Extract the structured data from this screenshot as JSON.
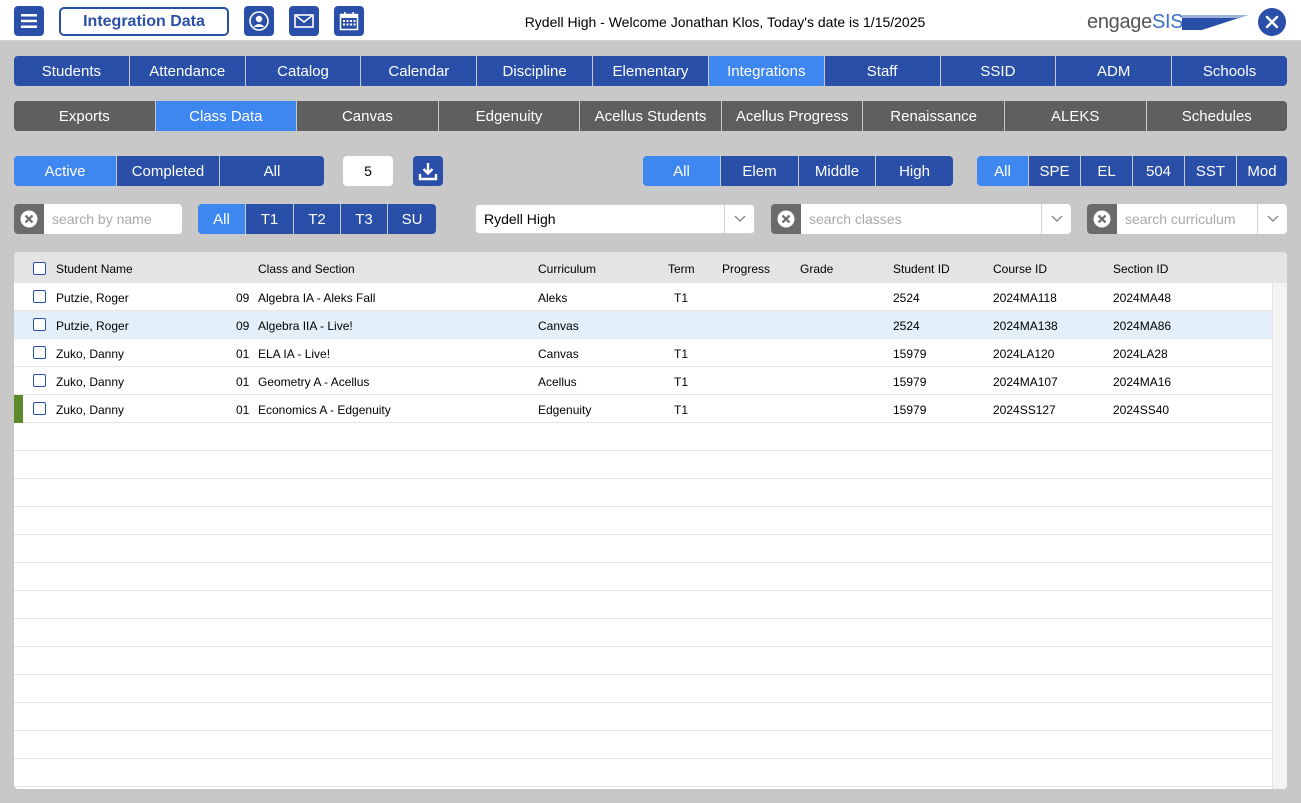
{
  "header": {
    "title": "Integration Data",
    "welcome": "Rydell High - Welcome Jonathan Klos, Today's date is 1/15/2025",
    "logo_engage": "engage",
    "logo_sis": "SIS"
  },
  "main_nav": [
    {
      "label": "Students",
      "active": false
    },
    {
      "label": "Attendance",
      "active": false
    },
    {
      "label": "Catalog",
      "active": false
    },
    {
      "label": "Calendar",
      "active": false
    },
    {
      "label": "Discipline",
      "active": false
    },
    {
      "label": "Elementary",
      "active": false
    },
    {
      "label": "Integrations",
      "active": true
    },
    {
      "label": "Staff",
      "active": false
    },
    {
      "label": "SSID",
      "active": false
    },
    {
      "label": "ADM",
      "active": false
    },
    {
      "label": "Schools",
      "active": false
    }
  ],
  "sub_nav": [
    {
      "label": "Exports",
      "active": false
    },
    {
      "label": "Class Data",
      "active": true
    },
    {
      "label": "Canvas",
      "active": false
    },
    {
      "label": "Edgenuity",
      "active": false
    },
    {
      "label": "Acellus Students",
      "active": false
    },
    {
      "label": "Acellus Progress",
      "active": false
    },
    {
      "label": "Renaissance",
      "active": false
    },
    {
      "label": "ALEKS",
      "active": false
    },
    {
      "label": "Schedules",
      "active": false
    }
  ],
  "status_filter": {
    "active": "Active",
    "completed": "Completed",
    "all": "All"
  },
  "count": "5",
  "level_filter": {
    "all": "All",
    "elem": "Elem",
    "middle": "Middle",
    "high": "High"
  },
  "program_filter": {
    "all": "All",
    "spe": "SPE",
    "el": "EL",
    "s504": "504",
    "sst": "SST",
    "mod": "Mod"
  },
  "term_filter": {
    "all": "All",
    "t1": "T1",
    "t2": "T2",
    "t3": "T3",
    "su": "SU"
  },
  "search_name": {
    "placeholder": "search by name"
  },
  "school_select": {
    "value": "Rydell High"
  },
  "search_classes": {
    "placeholder": "search classes"
  },
  "search_curriculum": {
    "placeholder": "search curriculum"
  },
  "table": {
    "columns": {
      "student_name": "Student Name",
      "class_section": "Class and Section",
      "curriculum": "Curriculum",
      "term": "Term",
      "progress": "Progress",
      "grade": "Grade",
      "student_id": "Student ID",
      "course_id": "Course ID",
      "section_id": "Section ID"
    },
    "rows": [
      {
        "name": "Putzie, Roger",
        "grade_level": "09",
        "class": "Algebra IA - Aleks Fall",
        "curriculum": "Aleks",
        "term": "T1",
        "progress": "",
        "grade": "",
        "student_id": "2524",
        "course_id": "2024MA118",
        "section_id": "2024MA48"
      },
      {
        "name": "Putzie, Roger",
        "grade_level": "09",
        "class": "Algebra IIA - Live!",
        "curriculum": "Canvas",
        "term": "",
        "progress": "",
        "grade": "",
        "student_id": "2524",
        "course_id": "2024MA138",
        "section_id": "2024MA86"
      },
      {
        "name": "Zuko, Danny",
        "grade_level": "01",
        "class": "ELA IA - Live!",
        "curriculum": "Canvas",
        "term": "T1",
        "progress": "",
        "grade": "",
        "student_id": "15979",
        "course_id": "2024LA120",
        "section_id": "2024LA28"
      },
      {
        "name": "Zuko, Danny",
        "grade_level": "01",
        "class": "Geometry A - Acellus",
        "curriculum": "Acellus",
        "term": "T1",
        "progress": "",
        "grade": "",
        "student_id": "15979",
        "course_id": "2024MA107",
        "section_id": "2024MA16"
      },
      {
        "name": "Zuko, Danny",
        "grade_level": "01",
        "class": "Economics A - Edgenuity",
        "curriculum": "Edgenuity",
        "term": "T1",
        "progress": "",
        "grade": "",
        "student_id": "15979",
        "course_id": "2024SS127",
        "section_id": "2024SS40"
      }
    ]
  },
  "colors": {
    "primary": "#2a4fa8",
    "active": "#3e86f0",
    "subnav": "#5f5f5f",
    "marker": "#5a8a2a",
    "selected_row": "#e3eff9"
  }
}
